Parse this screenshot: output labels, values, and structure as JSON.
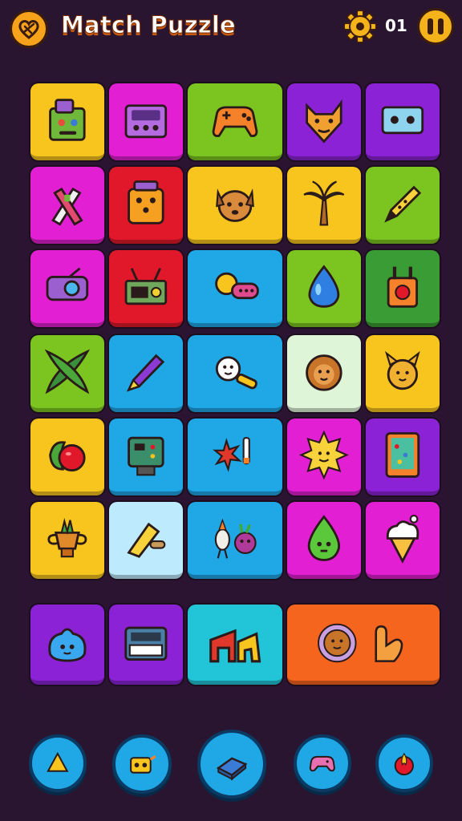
{
  "header": {
    "title": "Match Puzzle",
    "score": "01",
    "logo_icon": "heart-swirl-icon",
    "settings_icon": "gear-icon",
    "pause_icon": "pause-icon"
  },
  "grid_rows": [
    [
      "robot-box-icon",
      "handheld-console-icon",
      "gamepad-icon",
      "fox-face-icon",
      "radio-box-icon"
    ],
    [
      "crayon-cross-icon",
      "dice-box-icon",
      "puppy-face-icon",
      "palm-tree-icon",
      "pencil-icon"
    ],
    [
      "camera-radio-icon",
      "retro-radio-icon",
      "sun-remote-icon",
      "water-drop-icon",
      "walkie-talkie-icon"
    ],
    [
      "leaf-cross-icon",
      "purple-crayon-icon",
      "smiling-sun-key-icon",
      "lion-face-icon",
      "cat-sun-icon"
    ],
    [
      "cherry-fruit-icon",
      "arcade-cabinet-icon",
      "splat-brush-icon",
      "happy-sun-icon",
      "colorful-tablet-icon"
    ],
    [
      "trophy-plant-icon",
      "chalk-roller-icon",
      "bird-and-radish-icon",
      "green-drop-face-icon",
      "ice-cream-cone-icon"
    ]
  ],
  "tray_row": [
    "blue-slime-icon",
    "keyboard-radio-icon",
    "arch-blocks-icon",
    "lion-flower-and-hand-icon"
  ],
  "powerups": [
    "cheese-wedge-icon",
    "robot-head-icon",
    "cake-slice-icon",
    "controller-icon",
    "flame-ball-icon"
  ],
  "colors": {
    "background": "#2a1530",
    "yellow": "#f7c51e",
    "magenta": "#e21fd3",
    "green": "#7cc520",
    "purple": "#8b22d6",
    "red": "#e0182a",
    "blue": "#1fa7e6",
    "orange": "#f5651e"
  }
}
